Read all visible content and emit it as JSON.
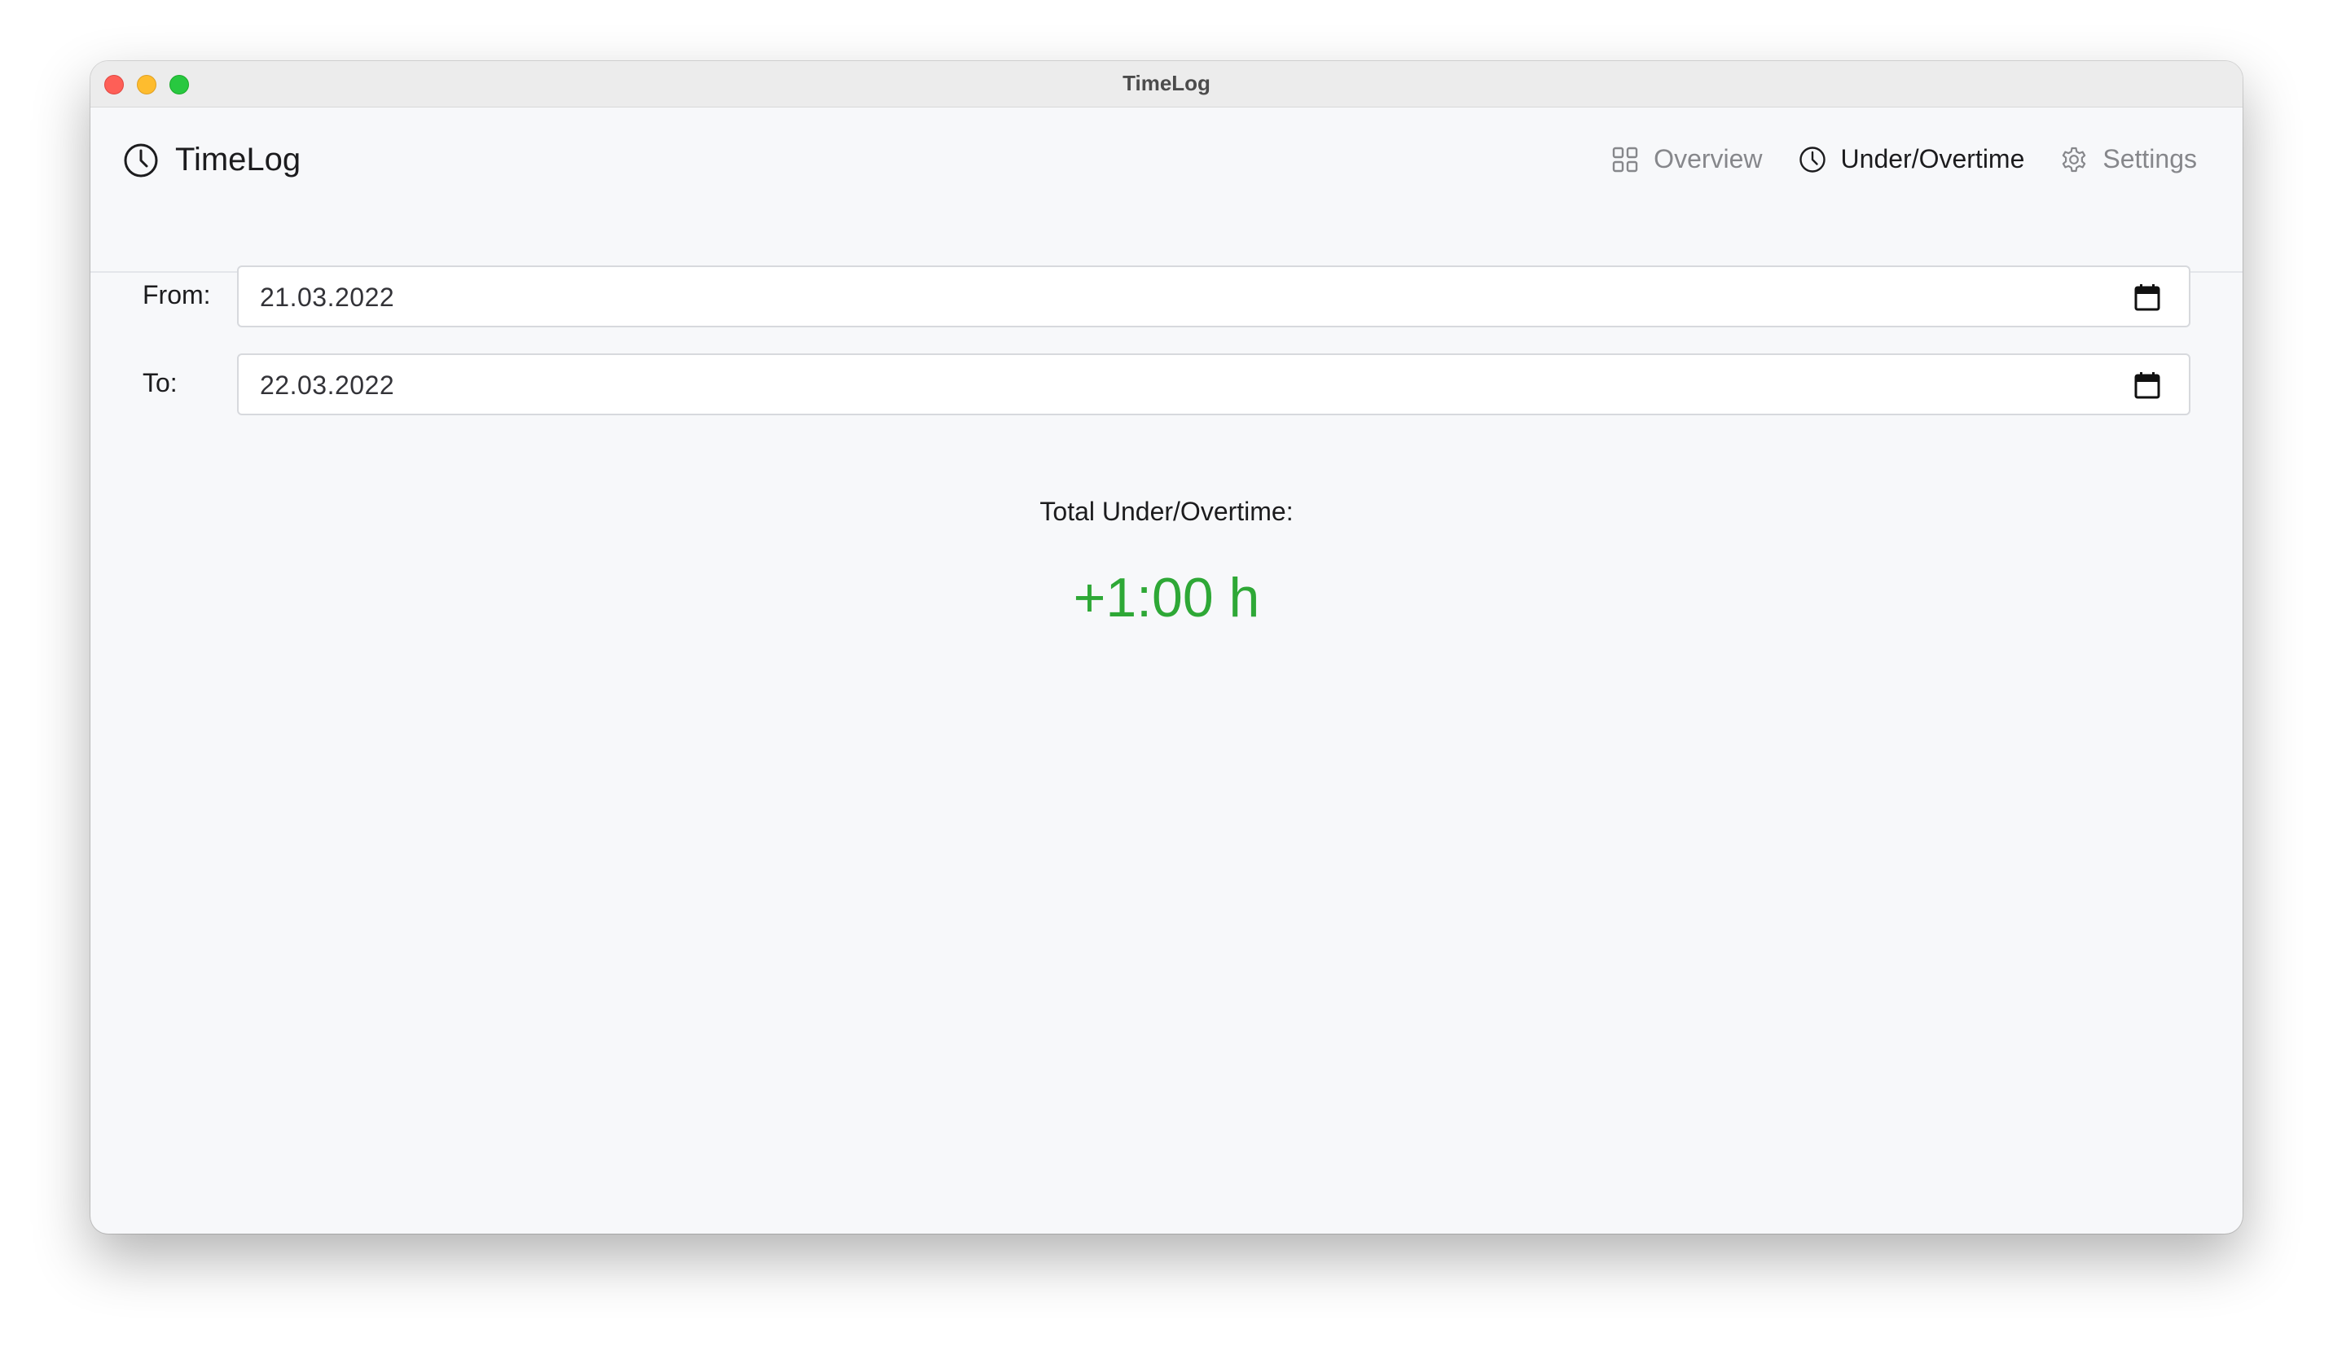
{
  "window": {
    "title": "TimeLog"
  },
  "app": {
    "brand": "TimeLog",
    "brand_icon": "clock-icon"
  },
  "nav": {
    "items": [
      {
        "label": "Overview",
        "icon": "grid-icon",
        "active": false
      },
      {
        "label": "Under/Overtime",
        "icon": "clock-icon",
        "active": true
      },
      {
        "label": "Settings",
        "icon": "gear-icon",
        "active": false
      }
    ]
  },
  "form": {
    "from_label": "From:",
    "from_value": "21.03.2022",
    "to_label": "To:",
    "to_value": "22.03.2022"
  },
  "summary": {
    "label": "Total Under/Overtime:",
    "value": "+1:00 h",
    "value_color": "#2ea836"
  }
}
